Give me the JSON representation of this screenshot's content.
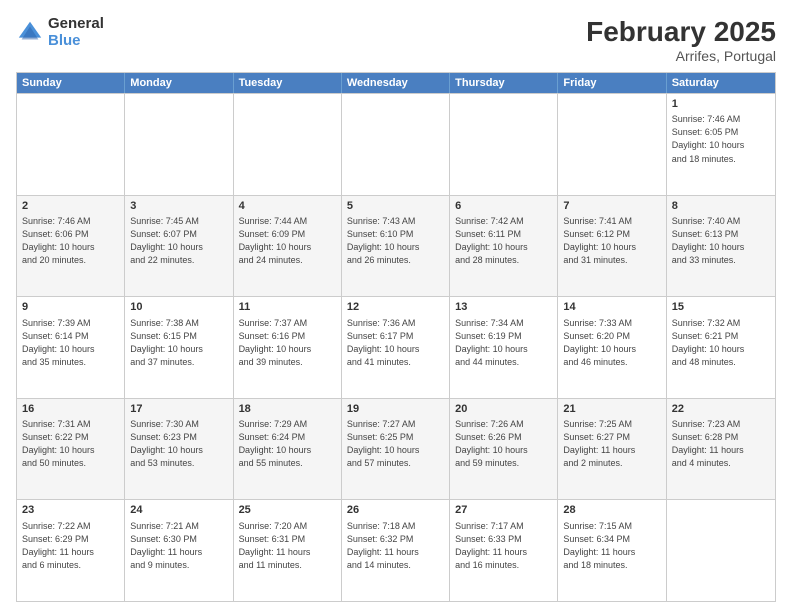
{
  "logo": {
    "general": "General",
    "blue": "Blue"
  },
  "header": {
    "month_year": "February 2025",
    "location": "Arrifes, Portugal"
  },
  "days": [
    "Sunday",
    "Monday",
    "Tuesday",
    "Wednesday",
    "Thursday",
    "Friday",
    "Saturday"
  ],
  "rows": [
    [
      {
        "day": "",
        "info": ""
      },
      {
        "day": "",
        "info": ""
      },
      {
        "day": "",
        "info": ""
      },
      {
        "day": "",
        "info": ""
      },
      {
        "day": "",
        "info": ""
      },
      {
        "day": "",
        "info": ""
      },
      {
        "day": "1",
        "info": "Sunrise: 7:46 AM\nSunset: 6:05 PM\nDaylight: 10 hours\nand 18 minutes."
      }
    ],
    [
      {
        "day": "2",
        "info": "Sunrise: 7:46 AM\nSunset: 6:06 PM\nDaylight: 10 hours\nand 20 minutes."
      },
      {
        "day": "3",
        "info": "Sunrise: 7:45 AM\nSunset: 6:07 PM\nDaylight: 10 hours\nand 22 minutes."
      },
      {
        "day": "4",
        "info": "Sunrise: 7:44 AM\nSunset: 6:09 PM\nDaylight: 10 hours\nand 24 minutes."
      },
      {
        "day": "5",
        "info": "Sunrise: 7:43 AM\nSunset: 6:10 PM\nDaylight: 10 hours\nand 26 minutes."
      },
      {
        "day": "6",
        "info": "Sunrise: 7:42 AM\nSunset: 6:11 PM\nDaylight: 10 hours\nand 28 minutes."
      },
      {
        "day": "7",
        "info": "Sunrise: 7:41 AM\nSunset: 6:12 PM\nDaylight: 10 hours\nand 31 minutes."
      },
      {
        "day": "8",
        "info": "Sunrise: 7:40 AM\nSunset: 6:13 PM\nDaylight: 10 hours\nand 33 minutes."
      }
    ],
    [
      {
        "day": "9",
        "info": "Sunrise: 7:39 AM\nSunset: 6:14 PM\nDaylight: 10 hours\nand 35 minutes."
      },
      {
        "day": "10",
        "info": "Sunrise: 7:38 AM\nSunset: 6:15 PM\nDaylight: 10 hours\nand 37 minutes."
      },
      {
        "day": "11",
        "info": "Sunrise: 7:37 AM\nSunset: 6:16 PM\nDaylight: 10 hours\nand 39 minutes."
      },
      {
        "day": "12",
        "info": "Sunrise: 7:36 AM\nSunset: 6:17 PM\nDaylight: 10 hours\nand 41 minutes."
      },
      {
        "day": "13",
        "info": "Sunrise: 7:34 AM\nSunset: 6:19 PM\nDaylight: 10 hours\nand 44 minutes."
      },
      {
        "day": "14",
        "info": "Sunrise: 7:33 AM\nSunset: 6:20 PM\nDaylight: 10 hours\nand 46 minutes."
      },
      {
        "day": "15",
        "info": "Sunrise: 7:32 AM\nSunset: 6:21 PM\nDaylight: 10 hours\nand 48 minutes."
      }
    ],
    [
      {
        "day": "16",
        "info": "Sunrise: 7:31 AM\nSunset: 6:22 PM\nDaylight: 10 hours\nand 50 minutes."
      },
      {
        "day": "17",
        "info": "Sunrise: 7:30 AM\nSunset: 6:23 PM\nDaylight: 10 hours\nand 53 minutes."
      },
      {
        "day": "18",
        "info": "Sunrise: 7:29 AM\nSunset: 6:24 PM\nDaylight: 10 hours\nand 55 minutes."
      },
      {
        "day": "19",
        "info": "Sunrise: 7:27 AM\nSunset: 6:25 PM\nDaylight: 10 hours\nand 57 minutes."
      },
      {
        "day": "20",
        "info": "Sunrise: 7:26 AM\nSunset: 6:26 PM\nDaylight: 10 hours\nand 59 minutes."
      },
      {
        "day": "21",
        "info": "Sunrise: 7:25 AM\nSunset: 6:27 PM\nDaylight: 11 hours\nand 2 minutes."
      },
      {
        "day": "22",
        "info": "Sunrise: 7:23 AM\nSunset: 6:28 PM\nDaylight: 11 hours\nand 4 minutes."
      }
    ],
    [
      {
        "day": "23",
        "info": "Sunrise: 7:22 AM\nSunset: 6:29 PM\nDaylight: 11 hours\nand 6 minutes."
      },
      {
        "day": "24",
        "info": "Sunrise: 7:21 AM\nSunset: 6:30 PM\nDaylight: 11 hours\nand 9 minutes."
      },
      {
        "day": "25",
        "info": "Sunrise: 7:20 AM\nSunset: 6:31 PM\nDaylight: 11 hours\nand 11 minutes."
      },
      {
        "day": "26",
        "info": "Sunrise: 7:18 AM\nSunset: 6:32 PM\nDaylight: 11 hours\nand 14 minutes."
      },
      {
        "day": "27",
        "info": "Sunrise: 7:17 AM\nSunset: 6:33 PM\nDaylight: 11 hours\nand 16 minutes."
      },
      {
        "day": "28",
        "info": "Sunrise: 7:15 AM\nSunset: 6:34 PM\nDaylight: 11 hours\nand 18 minutes."
      },
      {
        "day": "",
        "info": ""
      }
    ]
  ]
}
